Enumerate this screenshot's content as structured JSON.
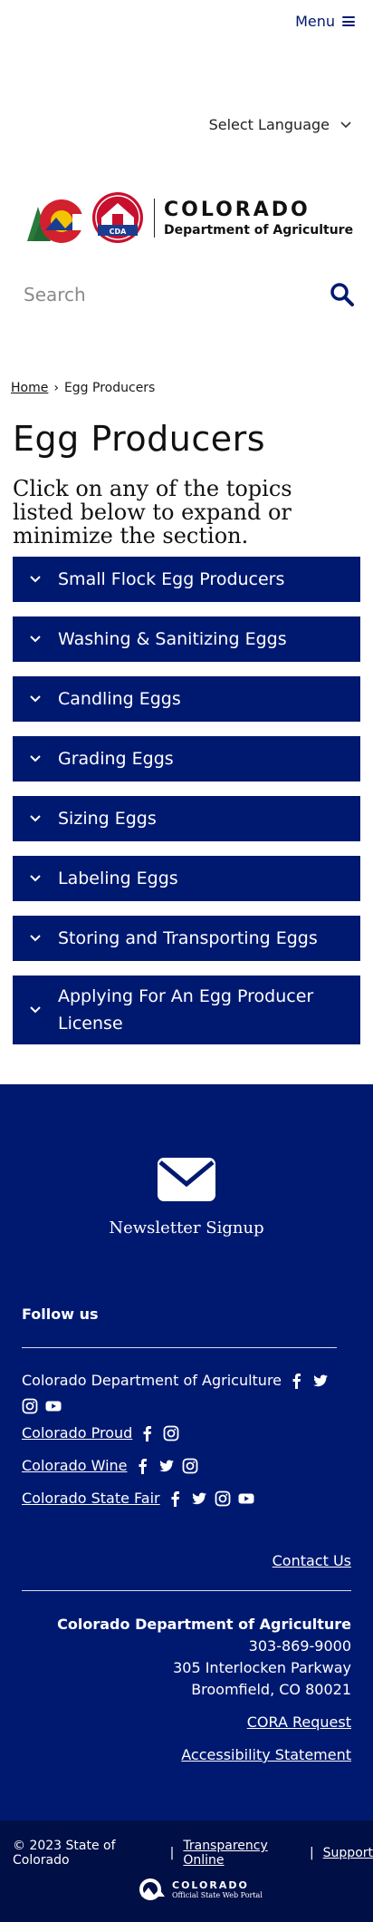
{
  "header": {
    "menu_label": "Menu",
    "language_label": "Select Language"
  },
  "logo": {
    "title": "COLORADO",
    "subtitle": "Department of Agriculture",
    "badge": "CDA"
  },
  "search": {
    "placeholder": "Search"
  },
  "breadcrumb": {
    "home": "Home",
    "separator": "›",
    "current": "Egg Producers"
  },
  "page": {
    "title": "Egg Producers",
    "intro": "Click on any of the topics listed below to expand or minimize the section."
  },
  "accordion": [
    {
      "label": "Small Flock Egg Producers"
    },
    {
      "label": "Washing & Sanitizing Eggs"
    },
    {
      "label": "Candling Eggs"
    },
    {
      "label": "Grading Eggs"
    },
    {
      "label": "Sizing Eggs"
    },
    {
      "label": "Labeling Eggs"
    },
    {
      "label": "Storing and Transporting Eggs"
    },
    {
      "label": "Applying For An Egg Producer License"
    }
  ],
  "footer": {
    "newsletter": "Newsletter Signup",
    "follow_us": "Follow us",
    "social": [
      {
        "name": "Colorado Department of Agriculture",
        "icons": [
          "facebook-icon",
          "twitter-icon",
          "instagram-icon",
          "youtube-icon"
        ]
      },
      {
        "name": "Colorado Proud",
        "icons": [
          "facebook-icon",
          "instagram-icon"
        ]
      },
      {
        "name": "Colorado Wine",
        "icons": [
          "facebook-icon",
          "twitter-icon",
          "instagram-icon"
        ]
      },
      {
        "name": "Colorado State Fair",
        "icons": [
          "facebook-icon",
          "twitter-icon",
          "instagram-icon",
          "youtube-icon"
        ]
      }
    ],
    "contact_us": "Contact Us",
    "org_name": "Colorado Department of Agriculture",
    "phone": "303-869-9000",
    "street": "305 Interlocken Parkway",
    "city": "Broomfield, CO 80021",
    "cora": "CORA Request",
    "accessibility": "Accessibility Statement"
  },
  "bottom": {
    "copyright": "© 2023 State of Colorado",
    "separator": "|",
    "transparency": "Transparency Online",
    "support": "Support",
    "state_logo_title": "COLORADO",
    "state_logo_sub": "Official State Web Portal"
  },
  "colors": {
    "brand_blue": "#001970",
    "bottom_bar": "#000f45"
  }
}
